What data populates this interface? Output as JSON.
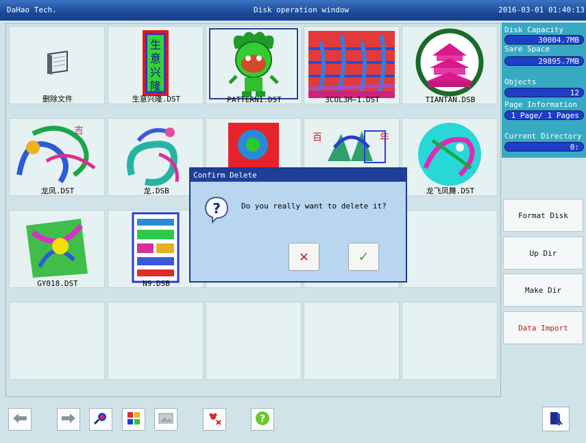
{
  "window": {
    "vendor": "DaHao Tech.",
    "title": "Disk operation window",
    "datetime": "2016-03-01 01:40:13"
  },
  "files": [
    {
      "name": "删除文件",
      "icon": "delete-file-icon",
      "selected": false
    },
    {
      "name": "生意兴隆.DST",
      "icon": "embroidery-thumbnail",
      "selected": false
    },
    {
      "name": "PATTERN1.DST",
      "icon": "embroidery-thumbnail",
      "selected": true
    },
    {
      "name": "3COL3M~1.DST",
      "icon": "embroidery-thumbnail",
      "selected": false
    },
    {
      "name": "TIANTAN.DSB",
      "icon": "embroidery-thumbnail",
      "selected": false
    },
    {
      "name": "龙凤.DST",
      "icon": "embroidery-thumbnail",
      "selected": false
    },
    {
      "name": "龙.DSB",
      "icon": "embroidery-thumbnail",
      "selected": false
    },
    {
      "name": "",
      "icon": "embroidery-thumbnail",
      "selected": false
    },
    {
      "name": "",
      "icon": "embroidery-thumbnail",
      "selected": false
    },
    {
      "name": "龙飞凤舞.DST",
      "icon": "embroidery-thumbnail",
      "selected": false
    },
    {
      "name": "GY018.DST",
      "icon": "embroidery-thumbnail",
      "selected": false
    },
    {
      "name": "N9.DSB",
      "icon": "embroidery-thumbnail",
      "selected": false
    }
  ],
  "info": {
    "disk_capacity_label": "Disk Capacity",
    "disk_capacity_value": "30004.7MB",
    "spare_space_label": "Sare Space",
    "spare_space_value": "29895.7MB",
    "objects_label": "Objects",
    "objects_value": "12",
    "page_info_label": "Page Information",
    "page_info_value": "1 Page/ 1 Pages",
    "current_dir_label": "Current Directory",
    "current_dir_value": "0:"
  },
  "side_buttons": {
    "format_disk": "Format Disk",
    "up_dir": "Up Dir",
    "make_dir": "Make Dir",
    "data_import": "Data Import"
  },
  "toolbar_icons": [
    "arrow-left-icon",
    "arrow-right-icon",
    "search-pattern-icon",
    "file-info-icon",
    "image-icon",
    "delete-pattern-icon",
    "help-icon",
    "exit-door-icon"
  ],
  "dialog": {
    "title": "Confirm Delete",
    "message": "Do you really want to delete it?",
    "cancel_glyph": "✕",
    "ok_glyph": "✓",
    "question_glyph": "?"
  },
  "colors": {
    "titlebar": "#1c4a98",
    "panel": "#37a9c3",
    "value_field": "#1e3ec8",
    "accent_red": "#c21a1a",
    "ok_green": "#3aa63a"
  }
}
